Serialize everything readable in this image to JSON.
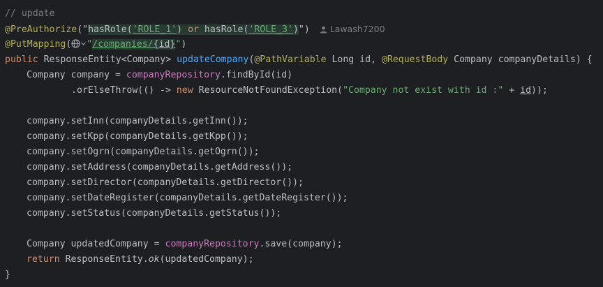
{
  "code": {
    "comment": "// update",
    "preauth": {
      "annotation": "@PreAuthorize",
      "open": "(\"",
      "call1": "hasRole(",
      "role1": "'ROLE_1'",
      "close1": ")",
      "or": " or ",
      "call2": "hasRole(",
      "role2": "'ROLE_3'",
      "close2": ")",
      "close": "\")"
    },
    "author": "Lawash7200",
    "putmapping": {
      "annotation": "@PutMapping",
      "open": "(",
      "q1": "\"",
      "path1": "/companies/",
      "path2": "{id}",
      "q2": "\"",
      "close": ")"
    },
    "signature": {
      "kw_public": "public",
      "type": " ResponseEntity<Company> ",
      "method": "updateCompany",
      "open": "(",
      "ann1": "@PathVariable",
      "p1": " Long id, ",
      "ann2": "@RequestBody",
      "p2": " Company companyDetails) {"
    },
    "line_find": {
      "pre": "Company company = ",
      "repo": "companyRepository",
      "post": ".findById(id)"
    },
    "line_throw": {
      "pre": ".orElseThrow(() -> ",
      "kw_new": "new",
      "cls": " ResourceNotFoundException(",
      "msg": "\"Company not exist with id :\"",
      "plus": " + ",
      "id": "id",
      "end": "));"
    },
    "setters": [
      "company.setInn(companyDetails.getInn());",
      "company.setKpp(companyDetails.getKpp());",
      "company.setOgrn(companyDetails.getOgrn());",
      "company.setAddress(companyDetails.getAddress());",
      "company.setDirector(companyDetails.getDirector());",
      "company.setDateRegister(companyDetails.getDateRegister());",
      "company.setStatus(companyDetails.getStatus());"
    ],
    "line_save": {
      "pre": "Company updatedCompany = ",
      "repo": "companyRepository",
      "post": ".save(company);"
    },
    "line_return": {
      "kw": "return",
      "pre": " ResponseEntity.",
      "ok": "ok",
      "post": "(updatedCompany);"
    },
    "closing_brace": "}"
  },
  "icons": {
    "author": "person-icon",
    "web": "globe-icon",
    "dropdown": "chevron-down-icon"
  },
  "colors": {
    "background": "#1e1f22",
    "text": "#bcbec4",
    "comment": "#7a7e85",
    "annotation": "#b3ae60",
    "keyword": "#cf8e6d",
    "string": "#6aab73",
    "method": "#56a8f5",
    "field": "#c77dbb",
    "injected_bg": "#283b32"
  }
}
